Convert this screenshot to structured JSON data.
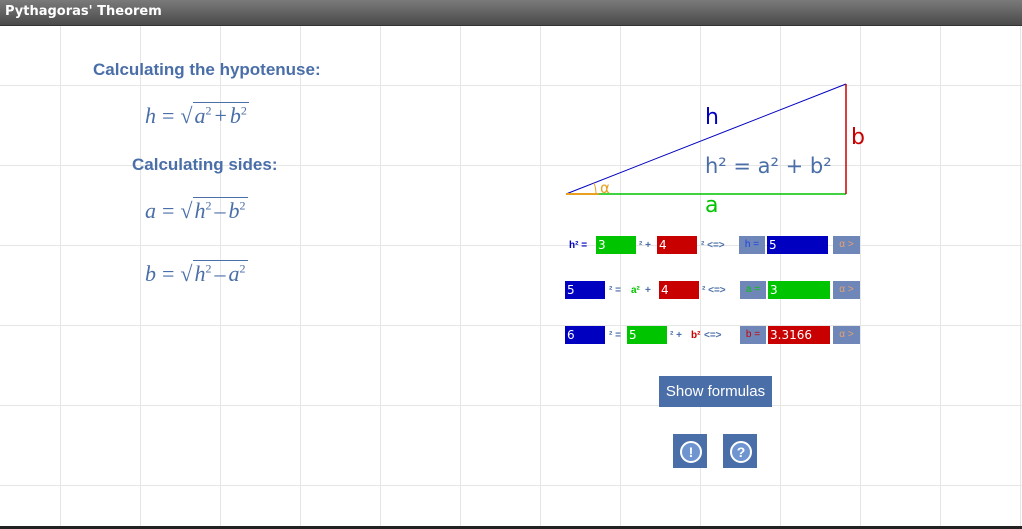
{
  "window": {
    "title": "Pythagoras' Theorem"
  },
  "formulas": {
    "hyp_heading": "Calculating the hypotenuse:",
    "sides_heading": "Calculating sides:",
    "h_lhs": "h",
    "h_rad1": "a",
    "h_rad2": "b",
    "a_lhs": "a",
    "a_rad1": "h",
    "a_rad2": "b",
    "b_lhs": "b",
    "b_rad1": "h",
    "b_rad2": "a",
    "eq": "=",
    "sqrt": "√",
    "plus": "+",
    "minus": "–",
    "sq": "2"
  },
  "triangle": {
    "label_h": "h",
    "label_b": "b",
    "label_a": "a",
    "label_alpha": "α",
    "equation": "h² = a² + b²"
  },
  "row1": {
    "prefix": "h² = ",
    "a_val": "3",
    "mid": "² + ",
    "b_val": "4",
    "suffix": "² <=> ",
    "res_label": "h = ",
    "res_val": "5",
    "calc": "α >"
  },
  "row2": {
    "h_val": "5",
    "mid1": "² = ",
    "a_lbl": "a²",
    "mid2": " + ",
    "b_val": "4",
    "suffix": "² <=> ",
    "res_label": "a = ",
    "res_val": "3",
    "calc": "α >"
  },
  "row3": {
    "h_val": "6",
    "mid1": "² = ",
    "a_val": "5",
    "mid2": "² + ",
    "b_lbl": "b²",
    "suffix": " <=> ",
    "res_label": "b = ",
    "res_val": "3.3166",
    "calc": "α >"
  },
  "buttons": {
    "show_formulas": "Show formulas",
    "info": "!",
    "help": "?"
  },
  "colors": {
    "accent": "#4a6ea8",
    "green": "#00c400",
    "red": "#c80000",
    "blue": "#0000c0",
    "orange": "#e8a020"
  }
}
